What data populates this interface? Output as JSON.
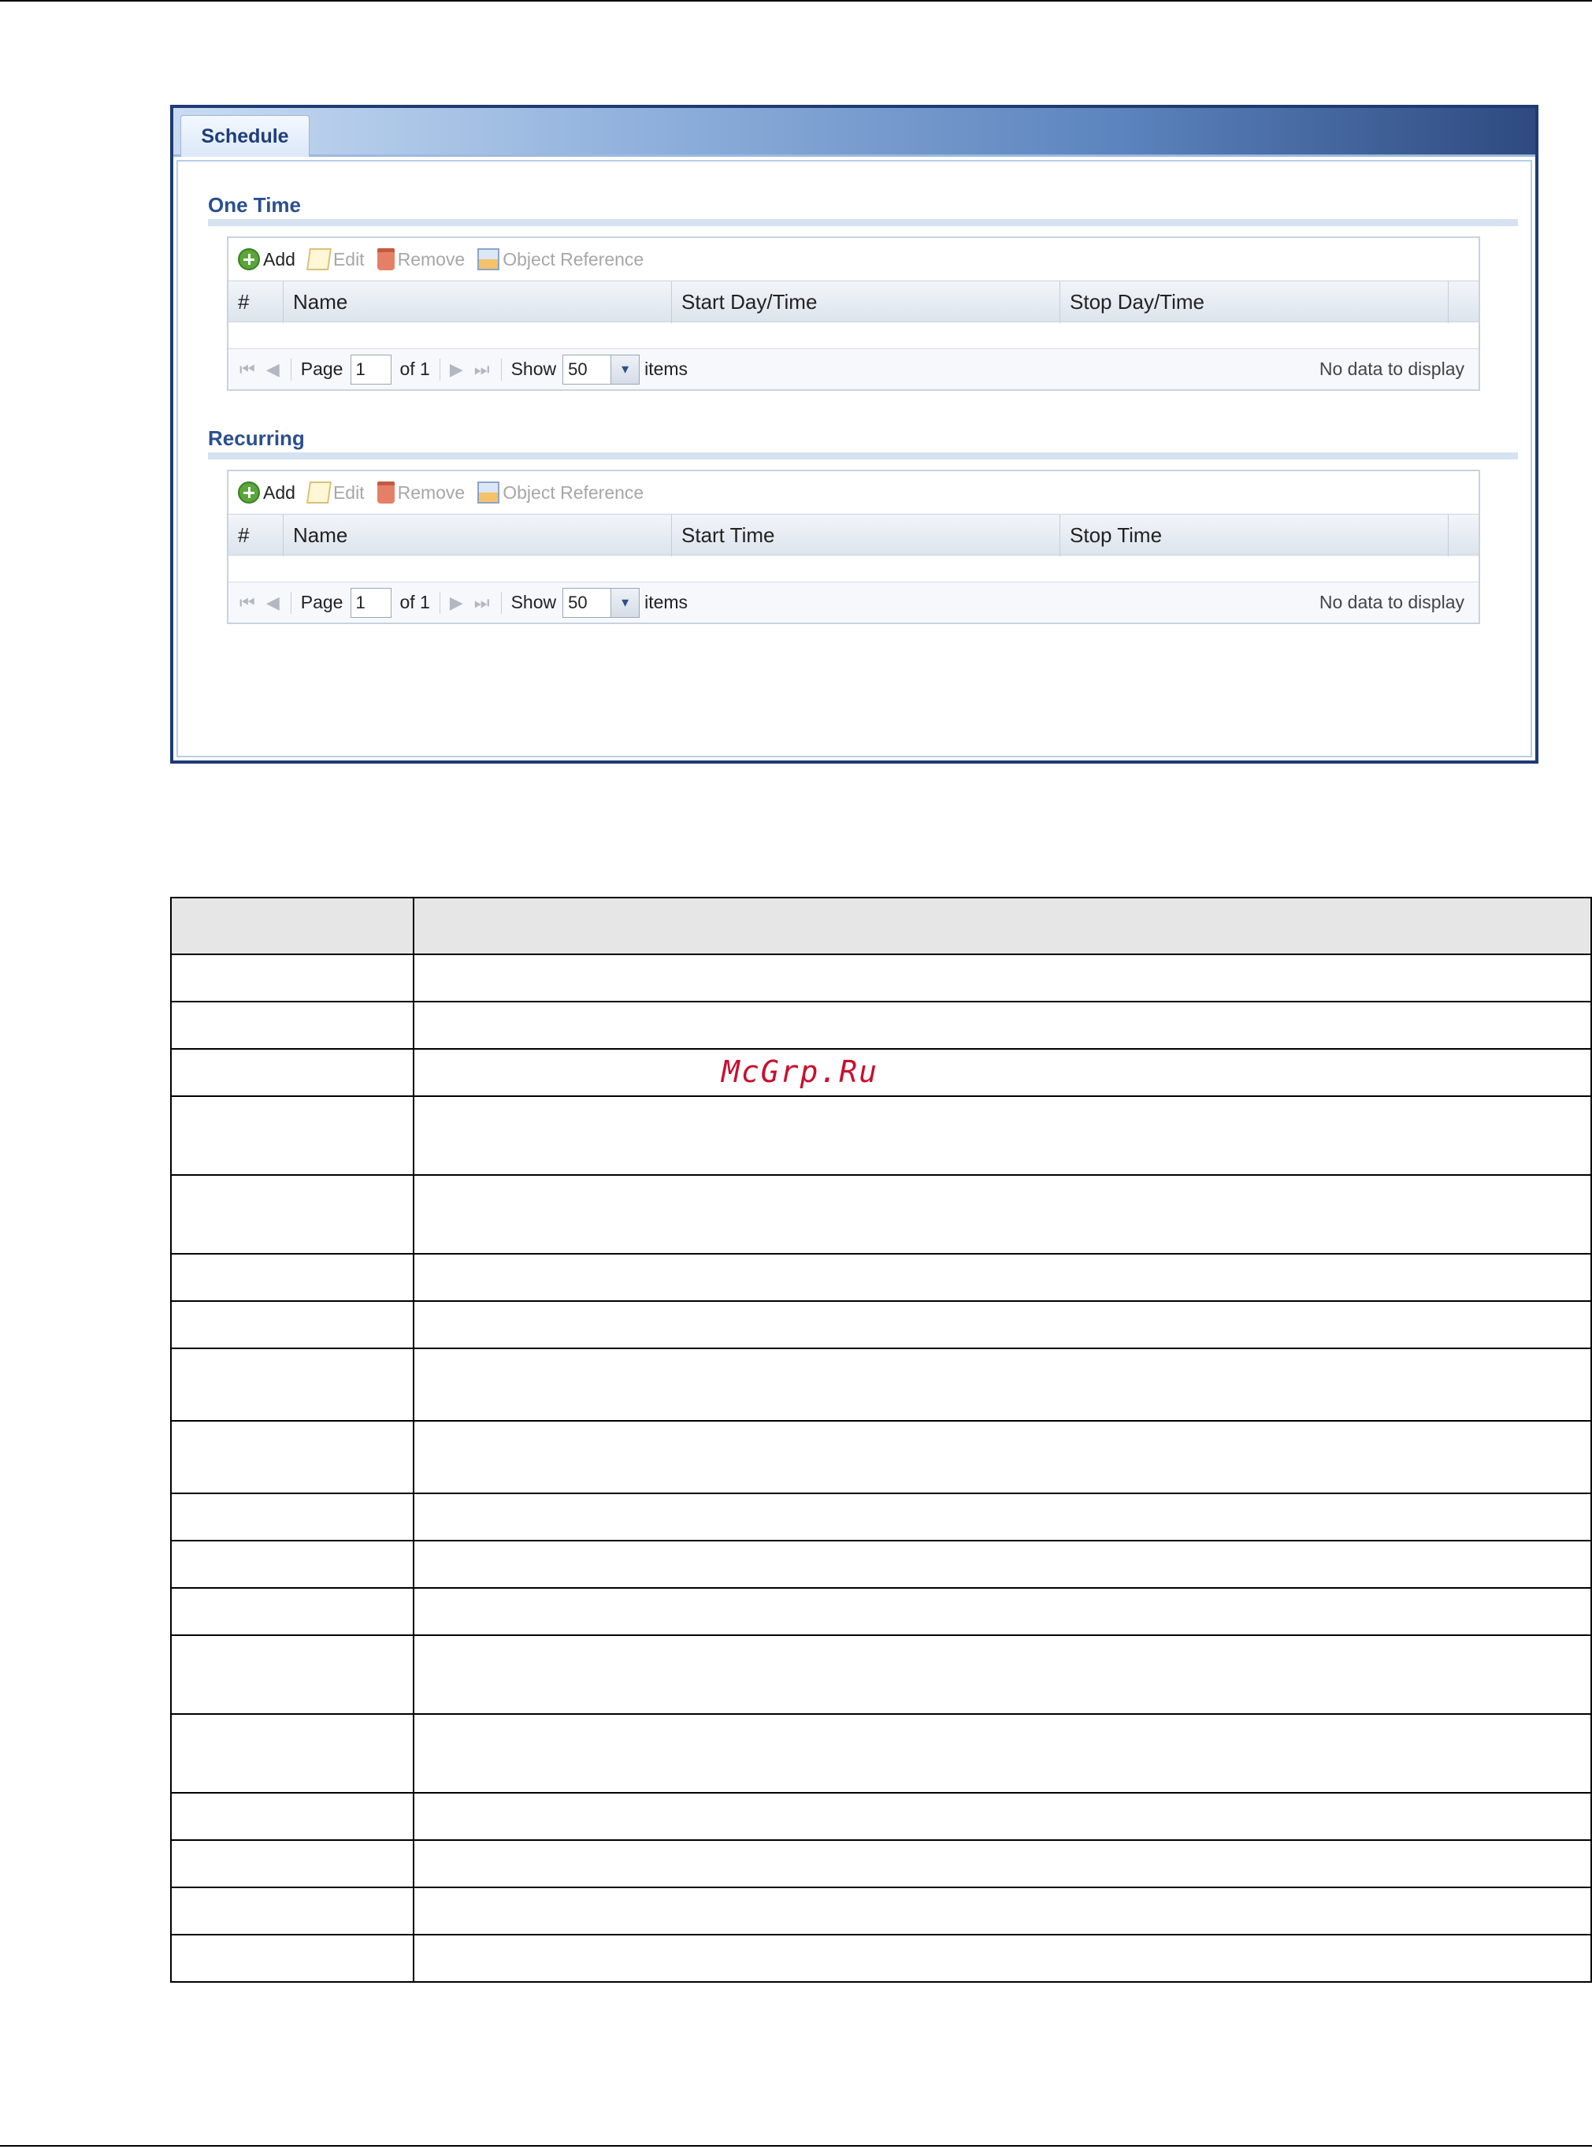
{
  "tab": {
    "label": "Schedule"
  },
  "one_time": {
    "title": "One Time",
    "toolbar": {
      "add": "Add",
      "edit": "Edit",
      "remove": "Remove",
      "object_reference": "Object Reference"
    },
    "columns": [
      "#",
      "Name",
      "Start Day/Time",
      "Stop Day/Time"
    ],
    "pager": {
      "page_label": "Page",
      "page_value": "1",
      "of_label": "of 1",
      "show_label": "Show",
      "show_value": "50",
      "items_label": "items",
      "status": "No data to display"
    }
  },
  "recurring": {
    "title": "Recurring",
    "toolbar": {
      "add": "Add",
      "edit": "Edit",
      "remove": "Remove",
      "object_reference": "Object Reference"
    },
    "columns": [
      "#",
      "Name",
      "Start Time",
      "Stop Time"
    ],
    "pager": {
      "page_label": "Page",
      "page_value": "1",
      "of_label": "of 1",
      "show_label": "Show",
      "show_value": "50",
      "items_label": "items",
      "status": "No data to display"
    }
  },
  "watermark": "McGrp.Ru",
  "colors": {
    "panel_border": "#1f3b73",
    "section_title": "#2a4f8e",
    "add_icon": "#5aa63a",
    "watermark": "#c8102e"
  }
}
